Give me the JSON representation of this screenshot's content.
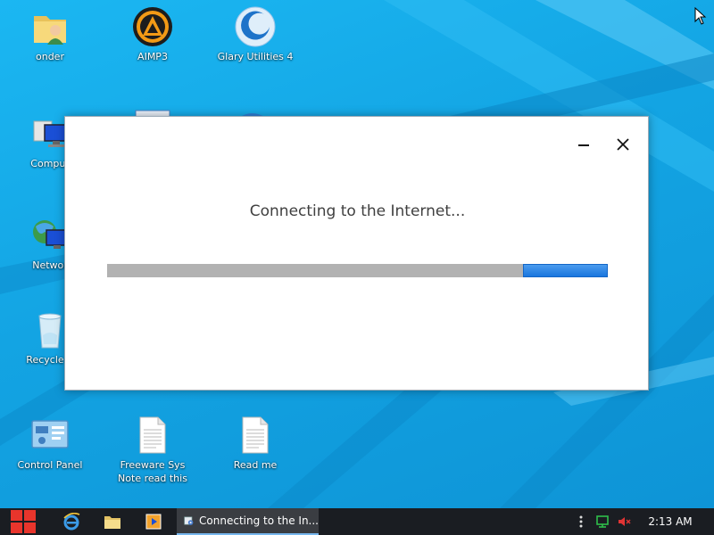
{
  "desktop": {
    "icons": [
      {
        "label": "onder",
        "icon": "user-folder-icon"
      },
      {
        "label": "AIMP3",
        "icon": "aimp-icon"
      },
      {
        "label": "Glary Utilities 4",
        "icon": "glary-utilities-icon"
      },
      {
        "label": "Comput",
        "icon": "computer-icon"
      },
      {
        "label": "Networ",
        "icon": "network-icon"
      },
      {
        "label": "Recycle B",
        "icon": "recycle-bin-icon"
      },
      {
        "label": "Control Panel",
        "icon": "control-panel-icon"
      },
      {
        "label": "Freeware Sys Note read this",
        "icon": "text-document-icon"
      },
      {
        "label": "Read me",
        "icon": "text-document-icon"
      }
    ],
    "colors": {
      "wallpaper": "#18a8e6",
      "wallpaper_ray": "#5fcaf6"
    }
  },
  "dialog": {
    "message": "Connecting to the Internet...",
    "progress": {
      "kind": "indeterminate-marquee",
      "chunk_start_fraction": 0.83,
      "chunk_end_fraction": 1.0
    },
    "buttons": {
      "minimize": "minimize-icon",
      "close": "close-icon"
    },
    "colors": {
      "progress_track": "#b2b2b2",
      "progress_chunk": "#1976de"
    }
  },
  "taskbar": {
    "pinned": [
      {
        "name": "internet-explorer",
        "icon": "internet-explorer-icon"
      },
      {
        "name": "file-explorer",
        "icon": "folder-icon"
      },
      {
        "name": "media-player",
        "icon": "media-player-icon"
      }
    ],
    "active_task": {
      "label": "Connecting to the In...",
      "icon": "setup-icon"
    },
    "tray": {
      "icons": [
        "overflow-icon",
        "network-status-icon",
        "volume-muted-icon"
      ]
    },
    "clock": "2:13 AM",
    "colors": {
      "background": "#1a1d22",
      "start_logo": "#e8352c"
    }
  }
}
